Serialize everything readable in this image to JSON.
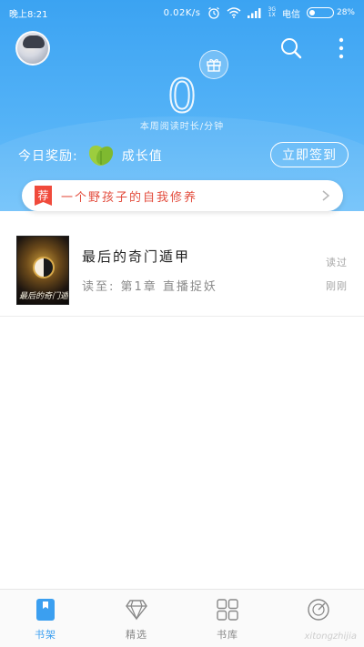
{
  "status_bar": {
    "time": "晚上8:21",
    "net_speed": "0.02K/s",
    "net_tag_top": "3G",
    "net_tag_bottom": "1X",
    "carrier": "电信",
    "battery": "28%",
    "battery_level": 0.28
  },
  "header": {
    "read_time_value": "0",
    "read_time_label": "本周阅读时长/分钟",
    "reward_label": "今日奖励:",
    "reward_value": "成长值",
    "signin_label": "立即签到"
  },
  "recommend": {
    "badge": "荐",
    "text": "一个野孩子的自我修养"
  },
  "books": [
    {
      "title": "最后的奇门遁甲",
      "progress": "读至: 第1章 直播捉妖",
      "meta_top": "读过",
      "meta_bottom": "刚刚",
      "cover_text": "最后的奇门遁甲"
    }
  ],
  "bottom_nav": [
    {
      "label": "书架",
      "icon": "bookshelf-icon",
      "active": true
    },
    {
      "label": "精选",
      "icon": "diamond-icon",
      "active": false
    },
    {
      "label": "书库",
      "icon": "grid-icon",
      "active": false
    },
    {
      "label": "",
      "icon": "discover-icon",
      "active": false
    }
  ],
  "watermark": "xitongzhijia",
  "colors": {
    "primary": "#3b9ff0",
    "header_top": "#3ba3f2",
    "recommend_text": "#e34d3e",
    "badge": "#f04a3b"
  }
}
